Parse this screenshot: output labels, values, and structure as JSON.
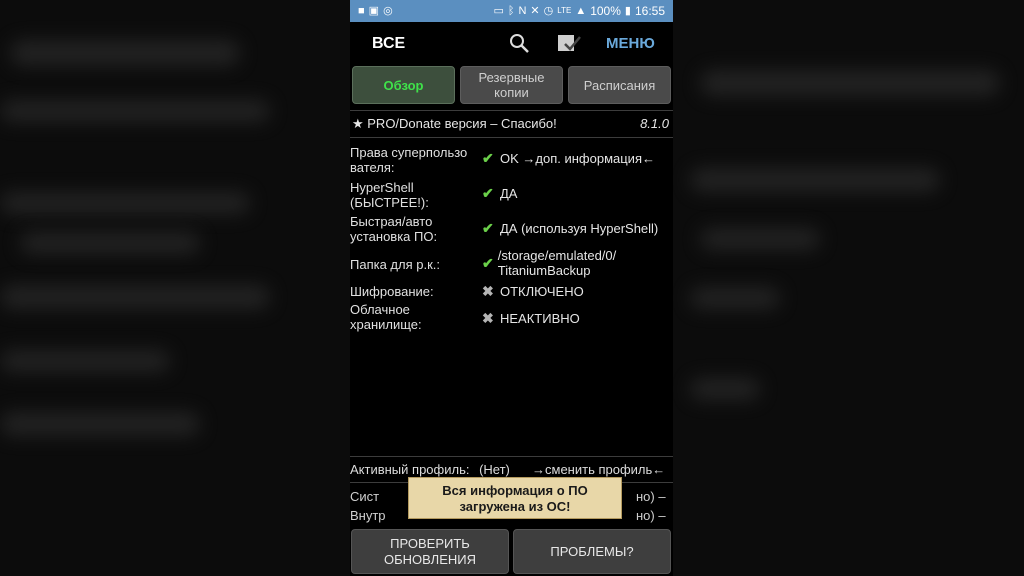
{
  "statusbar": {
    "battery": "100%",
    "time": "16:55",
    "network": "LTE"
  },
  "actionbar": {
    "title": "ВСЕ",
    "menu_label": "МЕНЮ"
  },
  "tabs": [
    {
      "label": "Обзор",
      "active": true
    },
    {
      "label": "Резервные копии",
      "active": false
    },
    {
      "label": "Расписания",
      "active": false
    }
  ],
  "pro": {
    "text": "★ PRO/Donate версия – Спасибо!",
    "version": "8.1.0"
  },
  "info_rows": [
    {
      "label": "Права суперпользо вателя:",
      "status": "ok",
      "value": "OK →доп. информация←"
    },
    {
      "label": "HyperShell (БЫСТРЕЕ!):",
      "status": "ok",
      "value": "ДА"
    },
    {
      "label": "Быстрая/авто установка ПО:",
      "status": "ok",
      "value": "ДА (используя HyperShell)"
    },
    {
      "label": "Папка для р.к.:",
      "status": "ok",
      "value": "/storage/emulated/0/ TitaniumBackup"
    },
    {
      "label": "Шифрование:",
      "status": "off",
      "value": "ОТКЛЮЧЕНО"
    },
    {
      "label": "Облачное хранилище:",
      "status": "off",
      "value": "НЕАКТИВНО"
    }
  ],
  "profile": {
    "label": "Активный профиль:",
    "value": "(Нет)",
    "action": "→сменить профиль←"
  },
  "storage": {
    "system_prefix": "Сист",
    "system_suffix": "но) –",
    "internal_prefix": "Внутр",
    "internal_suffix": "но) –"
  },
  "toast": {
    "text": "Вся информация о ПО загружена из ОС!"
  },
  "buttons": {
    "check_updates": "ПРОВЕРИТЬ ОБНОВЛЕНИЯ",
    "problems": "ПРОБЛЕМЫ?"
  },
  "colors": {
    "accent_green": "#3fe24a",
    "statusbar": "#5b8fc0",
    "menu_blue": "#6aa9db"
  }
}
